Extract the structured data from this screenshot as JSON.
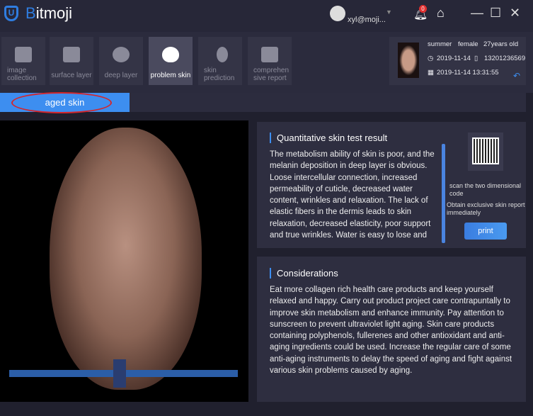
{
  "app": {
    "brand_first": "B",
    "brand_rest": "itmoji",
    "logo_letter": "U",
    "user": "xyl@moji...",
    "notifications": "0"
  },
  "tabs": [
    {
      "label": "image collection"
    },
    {
      "label": "surface layer"
    },
    {
      "label": "deep layer"
    },
    {
      "label": "problem skin"
    },
    {
      "label": "skin prediction"
    },
    {
      "label": "comprehensive report"
    }
  ],
  "patient": {
    "name": "summer",
    "gender": "female",
    "age": "27years old",
    "date": "2019-11-14",
    "phone": "13201236569",
    "datetime": "2019-11-14 13:31:55"
  },
  "subtab": "aged skin",
  "result": {
    "title": "Quantitative skin test result",
    "text": "The metabolism ability of skin is poor, and the melanin deposition in deep layer is obvious. Loose intercellular connection, increased permeability of cuticle, decreased water content, wrinkles and relaxation. The lack of elastic fibers in the dermis leads to skin relaxation, decreased elasticity, poor support and true wrinkles. Water is easy to lose and dry"
  },
  "qr": {
    "scan": "scan the two dimensional code",
    "obtain": "Obtain exclusive skin report immediately",
    "print": "print"
  },
  "considerations": {
    "title": "Considerations",
    "text": "Eat more collagen rich health care products and keep yourself relaxed and happy. Carry out product project care contrapuntally to improve skin metabolism and enhance immunity. Pay attention to sunscreen to prevent ultraviolet light aging. Skin care products containing polyphenols, fullerenes and other antioxidant and anti-aging ingredients could be used. Increase the regular care of some anti-aging instruments to delay the speed of aging and fight against various skin problems caused by aging."
  }
}
